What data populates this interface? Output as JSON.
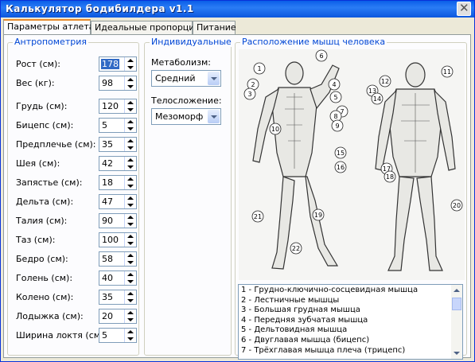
{
  "window": {
    "title": "Калькулятор бодибилдера v1.1"
  },
  "tabs": [
    {
      "label": "Параметры атлета"
    },
    {
      "label": "Идеальные пропорции"
    },
    {
      "label": "Питание"
    }
  ],
  "anthropometry": {
    "title": "Антропометрия",
    "fields": [
      {
        "label": "Рост (см):",
        "value": "178"
      },
      {
        "label": "Вес (кг):",
        "value": "98"
      },
      {
        "label": "Грудь (см):",
        "value": "120"
      },
      {
        "label": "Бицепс (см):",
        "value": "5"
      },
      {
        "label": "Предплечье (см):",
        "value": "35"
      },
      {
        "label": "Шея (см):",
        "value": "42"
      },
      {
        "label": "Запястье (см):",
        "value": "18"
      },
      {
        "label": "Дельта (см):",
        "value": "47"
      },
      {
        "label": "Талия (см):",
        "value": "90"
      },
      {
        "label": "Таз (см):",
        "value": "100"
      },
      {
        "label": "Бедро (см):",
        "value": "58"
      },
      {
        "label": "Голень (см):",
        "value": "40"
      },
      {
        "label": "Колено (см):",
        "value": "35"
      },
      {
        "label": "Лодыжка (см):",
        "value": "20"
      },
      {
        "label": "Ширина локтя (см):",
        "value": "5"
      }
    ]
  },
  "individual": {
    "title": "Индивидуальные",
    "metabolism_label": "Метаболизм:",
    "metabolism_value": "Средний",
    "physique_label": "Телосложение:",
    "physique_value": "Мезоморф"
  },
  "muscles": {
    "title": "Расположение мышц человека",
    "figure_numbers": [
      "1",
      "2",
      "3",
      "4",
      "5",
      "6",
      "7",
      "8",
      "9",
      "10",
      "11",
      "12",
      "13",
      "14",
      "15",
      "16",
      "17",
      "18",
      "19",
      "20",
      "21",
      "22"
    ],
    "list": [
      "1 - Грудно-ключично-сосцевидная мышца",
      "2 - Лестничные мышцы",
      "3 - Большая грудная мышца",
      "4 - Передняя зубчатая мышца",
      "5 - Дельтовидная мышца",
      "6 - Двуглавая мышца (бицепс)",
      "7 - Трёхглавая мышца плеча (трицепс)"
    ]
  },
  "colors": {
    "title_bar": "#0a5ee8",
    "group_title": "#0046d5",
    "selection": "#316ac5"
  }
}
